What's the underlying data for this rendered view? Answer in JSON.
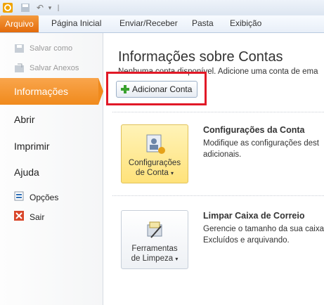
{
  "ribbon": {
    "file_tab": "Arquivo",
    "tabs": [
      "Página Inicial",
      "Enviar/Receber",
      "Pasta",
      "Exibição"
    ]
  },
  "sidebar": {
    "save_as": "Salvar como",
    "save_attachments": "Salvar Anexos",
    "info": "Informações",
    "open": "Abrir",
    "print": "Imprimir",
    "help": "Ajuda",
    "options": "Opções",
    "exit": "Sair"
  },
  "main": {
    "title": "Informações sobre Contas",
    "subtitle": "Nenhuma conta disponível. Adicione uma conta de ema",
    "add_account": "Adicionar Conta",
    "account_settings": {
      "button_line1": "Configurações",
      "button_line2": "de Conta",
      "heading": "Configurações da Conta",
      "desc_line1": "Modifique as configurações dest",
      "desc_line2": "adicionais."
    },
    "cleanup": {
      "button_line1": "Ferramentas",
      "button_line2": "de Limpeza",
      "heading": "Limpar Caixa de Correio",
      "desc_line1": "Gerencie o tamanho da sua caixa",
      "desc_line2": "Excluídos e arquivando."
    }
  },
  "colors": {
    "accent": "#f08a1c",
    "highlight": "#e11927"
  }
}
